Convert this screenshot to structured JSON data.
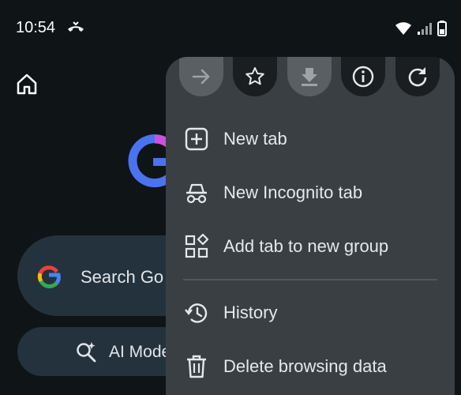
{
  "status_bar": {
    "time": "10:54",
    "icons": [
      "call-forward-icon",
      "wifi-icon",
      "signal-icon",
      "battery-icon"
    ]
  },
  "page": {
    "home_icon": "home-icon",
    "logo": "google-logo",
    "search_label": "Search Go",
    "ai_mode_label": "AI Mode"
  },
  "menu": {
    "toolbar": [
      {
        "name": "forward-icon",
        "enabled": false
      },
      {
        "name": "star-icon",
        "enabled": true
      },
      {
        "name": "download-icon",
        "enabled": false
      },
      {
        "name": "info-icon",
        "enabled": true
      },
      {
        "name": "refresh-icon",
        "enabled": true
      }
    ],
    "items": [
      {
        "label": "New tab",
        "icon": "plus-box-icon"
      },
      {
        "label": "New Incognito tab",
        "icon": "incognito-icon"
      },
      {
        "label": "Add tab to new group",
        "icon": "tab-group-icon"
      },
      {
        "label": "History",
        "icon": "history-icon"
      },
      {
        "label": "Delete browsing data",
        "icon": "trash-icon"
      }
    ]
  },
  "colors": {
    "background": "#0f1417",
    "menu": "#3a3f44",
    "pill": "#24323e"
  }
}
